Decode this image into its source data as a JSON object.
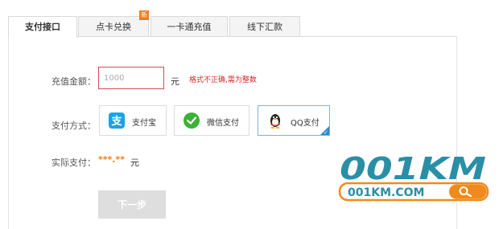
{
  "tabs": [
    {
      "label": "支付接口",
      "active": true
    },
    {
      "label": "点卡兑换",
      "badge": "新"
    },
    {
      "label": "一卡通充值"
    },
    {
      "label": "线下汇款"
    }
  ],
  "form": {
    "amount_label": "充值金额：",
    "amount_value": "1000",
    "amount_unit": "元",
    "amount_error": "格式不正确,需为整数",
    "method_label": "支付方式：",
    "methods": [
      {
        "label": "支付宝",
        "icon": "alipay-icon",
        "color": "#1aa3e8",
        "selected": false
      },
      {
        "label": "微信支付",
        "icon": "wechat-icon",
        "color": "#3bb135",
        "selected": false
      },
      {
        "label": "QQ支付",
        "icon": "qq-penguin-icon",
        "color": "#222222",
        "selected": true
      }
    ],
    "actual_label": "实际支付：",
    "actual_value": "***.**",
    "actual_unit": "元",
    "next_button": "下一步"
  },
  "watermark": {
    "brand": "001KM",
    "url": "001KM.COM",
    "colors": {
      "teal": "#2a8fa6",
      "orange": "#f08a1c"
    }
  }
}
